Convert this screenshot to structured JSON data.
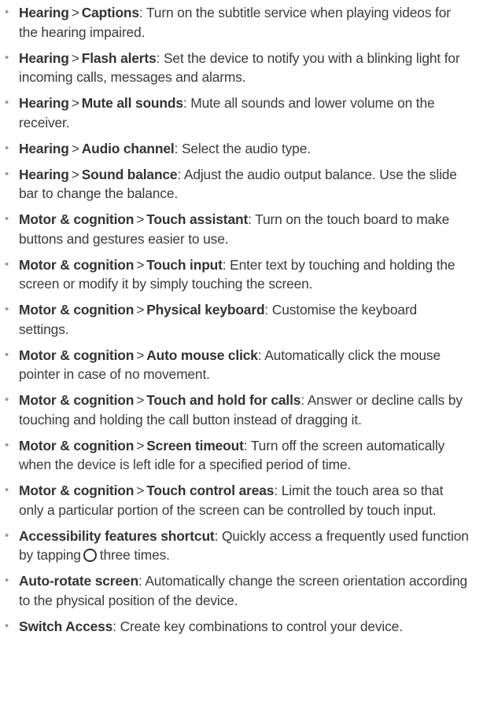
{
  "items": [
    {
      "path": [
        "Hearing",
        "Captions"
      ],
      "desc": "Turn on the subtitle service when playing videos for the hearing impaired."
    },
    {
      "path": [
        "Hearing",
        "Flash alerts"
      ],
      "desc": "Set the device to notify you with a blinking light for incoming calls, messages and alarms."
    },
    {
      "path": [
        "Hearing",
        "Mute all sounds"
      ],
      "desc": "Mute all sounds and lower volume on the receiver."
    },
    {
      "path": [
        "Hearing",
        "Audio channel"
      ],
      "desc": "Select the audio type."
    },
    {
      "path": [
        "Hearing",
        "Sound balance"
      ],
      "desc": "Adjust the audio output balance. Use the slide bar to change the balance."
    },
    {
      "path": [
        "Motor & cognition",
        "Touch assistant"
      ],
      "desc": "Turn on the touch board to make buttons and gestures easier to use."
    },
    {
      "path": [
        "Motor & cognition",
        "Touch input"
      ],
      "desc": "Enter text by touching and holding the screen or modify it by simply touching the screen."
    },
    {
      "path": [
        "Motor & cognition",
        "Physical keyboard"
      ],
      "desc": "Customise the keyboard settings."
    },
    {
      "path": [
        "Motor & cognition",
        "Auto mouse click"
      ],
      "desc": "Automatically click the mouse pointer in case of no movement."
    },
    {
      "path": [
        "Motor & cognition",
        "Touch and hold for calls"
      ],
      "desc": "Answer or decline calls by touching and holding the call button instead of dragging it."
    },
    {
      "path": [
        "Motor & cognition",
        "Screen timeout"
      ],
      "desc": "Turn off the screen automatically when the device is left idle for a specified period of time."
    },
    {
      "path": [
        "Motor & cognition",
        "Touch control areas"
      ],
      "desc": "Limit the touch area so that only a particular portion of the screen can be controlled by touch input."
    },
    {
      "path": [
        "Accessibility features shortcut"
      ],
      "desc": "Quickly access a frequently used function by tapping",
      "icon": "home-button-icon",
      "desc_after": "three times."
    },
    {
      "path": [
        "Auto-rotate screen"
      ],
      "desc": "Automatically change the screen orientation according to the physical position of the device."
    },
    {
      "path": [
        "Switch Access"
      ],
      "desc": "Create key combinations to control your device."
    }
  ],
  "bullet": "•",
  "separator": ">"
}
